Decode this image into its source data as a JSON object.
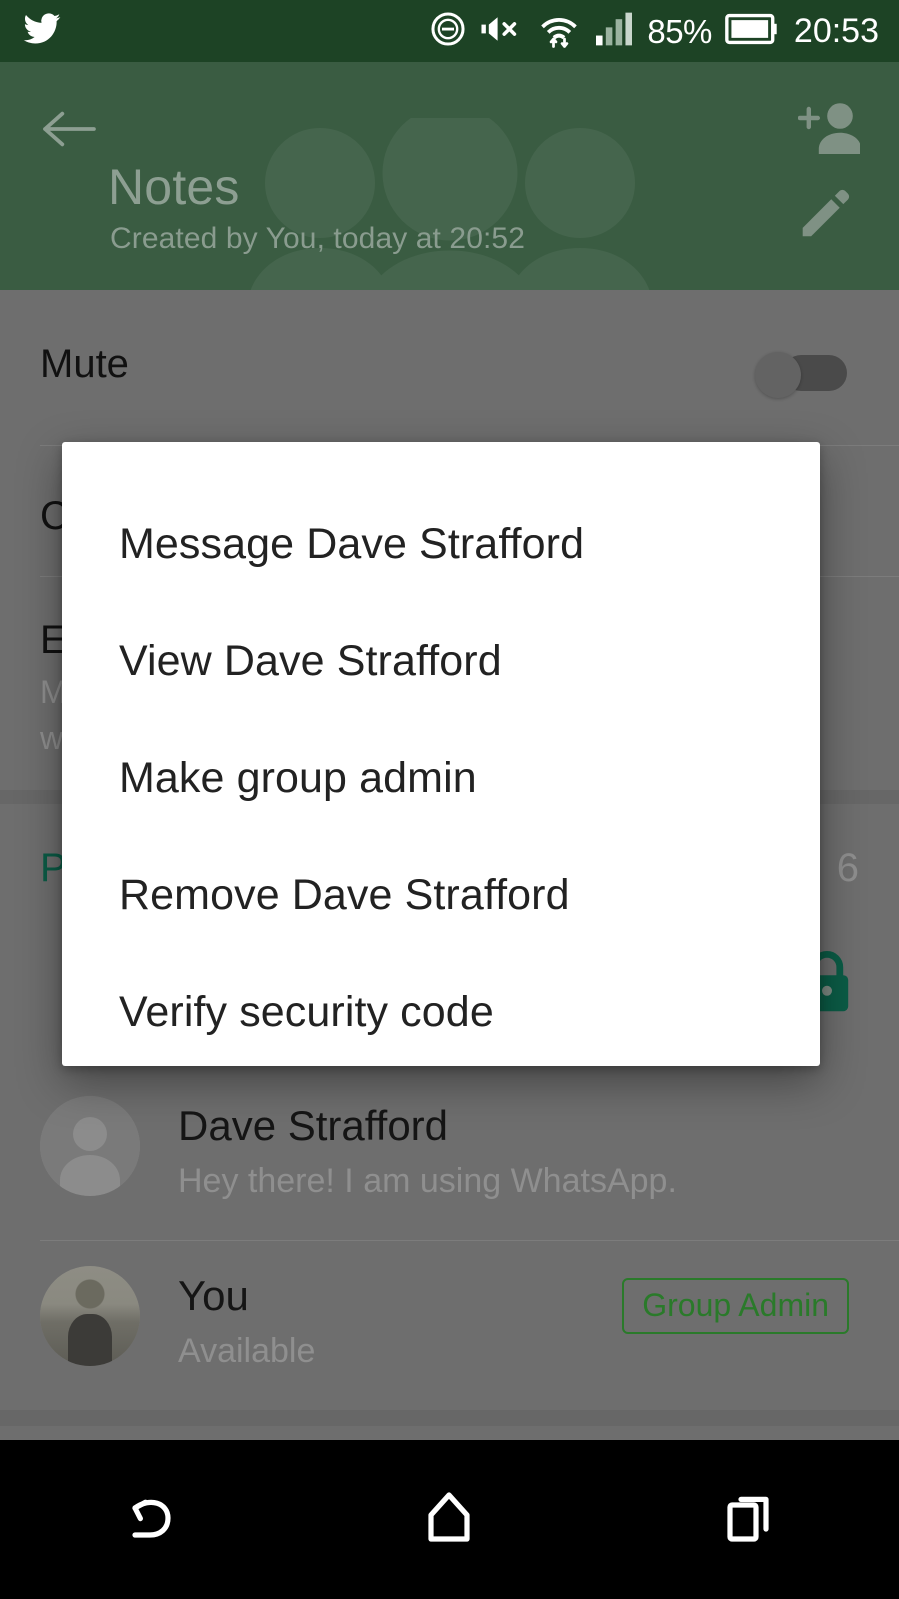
{
  "status_bar": {
    "app_icon": "twitter-bird-icon",
    "icons": [
      "do-not-disturb-icon",
      "volume-mute-icon",
      "wifi-icon",
      "cellular-signal-icon"
    ],
    "battery_percent": "85%",
    "battery_icon": "battery-icon",
    "clock": "20:53",
    "background_color": "#1d4325",
    "foreground_color": "#ffffff"
  },
  "app_bar": {
    "back_icon": "back-arrow-icon",
    "add_person_icon": "add-person-icon",
    "edit_icon": "edit-pencil-icon",
    "title": "Notes",
    "subtitle": "Created by You, today at 20:52",
    "background_color": "#3a5c42"
  },
  "settings": {
    "mute": {
      "label": "Mute",
      "toggle_state": "off"
    },
    "custom_notifications": {
      "label_visible_fragment": "C"
    },
    "encryption": {
      "label_visible_fragment": "E",
      "description_line1_fragment": "M",
      "description_line2_fragment": "w",
      "lock_icon": "lock-icon",
      "lock_color": "#0b5c46"
    },
    "participants": {
      "label_visible_fragment": "P",
      "count": "6",
      "accent_color": "#0b5c46"
    }
  },
  "participants": [
    {
      "name": "Dave Strafford",
      "status": "Hey there! I am using WhatsApp.",
      "avatar": "default-avatar-icon",
      "badge": ""
    },
    {
      "name": "You",
      "status": "Available",
      "avatar": "profile-photo",
      "badge": "Group Admin"
    }
  ],
  "dialog": {
    "items": [
      "Message Dave Strafford",
      "View Dave Strafford",
      "Make group admin",
      "Remove Dave Strafford",
      "Verify security code"
    ]
  },
  "nav_bar": {
    "back_icon": "nav-back-icon",
    "home_icon": "nav-home-icon",
    "recents_icon": "nav-recents-icon",
    "background_color": "#000000"
  }
}
